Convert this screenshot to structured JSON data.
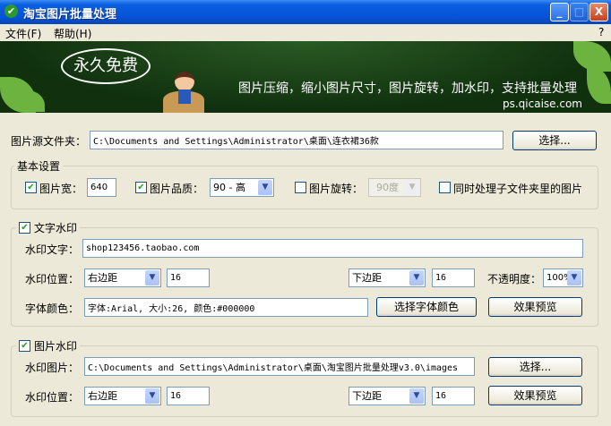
{
  "window": {
    "title": "淘宝图片批量处理",
    "minimize": "_",
    "maximize": "□",
    "close": "X"
  },
  "menu": {
    "file": "文件(F)",
    "help": "帮助(H)",
    "help_q": "?"
  },
  "banner": {
    "badge": "永久免费",
    "slogan": "图片压缩，缩小图片尺寸，图片旋转，加水印，支持批量处理",
    "url": "ps.qicaise.com"
  },
  "source": {
    "label": "图片源文件夹：",
    "value": "C:\\Documents and Settings\\Administrator\\桌面\\连衣裙36款",
    "button": "选择..."
  },
  "basic": {
    "legend": "基本设置",
    "width_label": "图片宽：",
    "width_checked": true,
    "width_value": "640",
    "quality_label": "图片品质：",
    "quality_checked": true,
    "quality_value": "90 - 高",
    "rotate_label": "图片旋转：",
    "rotate_checked": false,
    "rotate_value": "90度",
    "subfolder_label": "同时处理子文件夹里的图片",
    "subfolder_checked": false
  },
  "text_wm": {
    "legend": "文字水印",
    "checked": true,
    "text_label": "水印文字：",
    "text_value": "shop123456.taobao.com",
    "pos_label": "水印位置：",
    "h_pos": "右边距",
    "h_val": "16",
    "v_pos": "下边距",
    "v_val": "16",
    "opacity_label": "不透明度：",
    "opacity": "100%",
    "font_label": "字体颜色：",
    "font_value": "字体:Arial, 大小:26, 颜色:#000000",
    "font_button": "选择字体颜色",
    "preview_button": "效果预览"
  },
  "img_wm": {
    "legend": "图片水印",
    "checked": true,
    "img_label": "水印图片：",
    "img_value": "C:\\Documents and Settings\\Administrator\\桌面\\淘宝图片批量处理v3.0\\images",
    "choose_button": "选择...",
    "pos_label": "水印位置：",
    "h_pos": "右边距",
    "h_val": "16",
    "v_pos": "下边距",
    "v_val": "16",
    "preview_button": "效果预览"
  },
  "check_mark": "✔",
  "dropdown_arrow": "▼"
}
